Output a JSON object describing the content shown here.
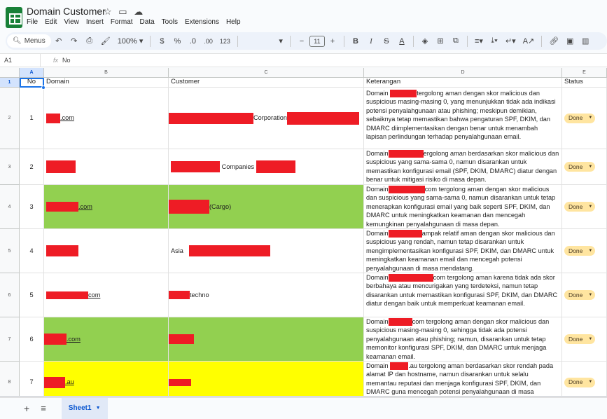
{
  "app": {
    "title": "Domain Customer",
    "icon": "sheets-logo-icon"
  },
  "title_icons": [
    "star-icon",
    "move-to-folder-icon",
    "cloud-status-icon"
  ],
  "menu": [
    "File",
    "Edit",
    "View",
    "Insert",
    "Format",
    "Data",
    "Tools",
    "Extensions",
    "Help"
  ],
  "toolbar": {
    "search_label": "Menus",
    "zoom": "100%",
    "currency": "$",
    "percent": "%",
    "decimal_decrease": ".0",
    "decimal_increase": ".00",
    "number_format": "123",
    "font_size": "11"
  },
  "formula_bar": {
    "name_box": "A1",
    "fx": "fx",
    "value": "No"
  },
  "columns": [
    "A",
    "B",
    "C",
    "D",
    "E"
  ],
  "rows": [
    "1",
    "2",
    "3",
    "4",
    "5",
    "6",
    "7",
    "8"
  ],
  "headers": {
    "no": "No",
    "domain": "Domain",
    "customer": "Customer",
    "keterangan": "Keterangan",
    "status": "Status"
  },
  "records": [
    {
      "no": "1",
      "domain_suffix": ".com",
      "customer_text": "Corporation",
      "keterangan": "tergolong aman dengan skor malicious dan suspicious masing-masing 0, yang menunjukkan tidak ada indikasi potensi penyalahgunaan atau phishing; meskipun demikian, sebaiknya tetap memastikan bahwa pengaturan SPF, DKIM, dan DMARC diimplementasikan dengan benar untuk menambah lapisan perlindungan terhadap penyalahgunaan email.",
      "status": "Done"
    },
    {
      "no": "2",
      "domain_suffix": "",
      "customer_text": "Companies",
      "keterangan": "ergolong aman berdasarkan skor malicious dan suspicious yang sama-sama 0, namun disarankan untuk memastikan konfigurasi email (SPF, DKIM, DMARC) diatur dengan benar untuk mitigasi risiko di masa depan.",
      "status": "Done"
    },
    {
      "no": "3",
      "domain_suffix": ".com",
      "customer_text": "(Cargo)",
      "keterangan": "com tergolong aman dengan skor malicious dan suspicious yang sama-sama 0, namun disarankan untuk tetap menerapkan konfigurasi email yang baik seperti SPF, DKIM, dan DMARC untuk meningkatkan keamanan dan mencegah kemungkinan penyalahgunaan di masa depan.",
      "status": "Done"
    },
    {
      "no": "4",
      "domain_suffix": "",
      "customer_text": "Asia",
      "keterangan": "ampak relatif aman dengan skor malicious dan suspicious yang rendah, namun tetap disarankan untuk mengimplementasikan konfigurasi SPF, DKIM, dan DMARC untuk meningkatkan keamanan email dan mencegah potensi penyalahgunaan di masa mendatang.",
      "status": "Done"
    },
    {
      "no": "5",
      "domain_suffix": "com",
      "customer_text": "techno",
      "keterangan": "com tergolong aman karena tidak ada skor berbahaya atau mencurigakan yang terdeteksi, namun tetap disarankan untuk memastikan konfigurasi SPF, DKIM, dan DMARC diatur dengan baik untuk memperkuat keamanan email.",
      "status": "Done"
    },
    {
      "no": "6",
      "domain_suffix": ".com",
      "customer_text": "",
      "keterangan": "com tergolong aman dengan skor malicious dan suspicious masing-masing 0, sehingga tidak ada potensi penyalahgunaan atau phishing; namun, disarankan untuk tetap memonitor konfigurasi SPF, DKIM, dan DMARC untuk menjaga keamanan email.",
      "status": "Done"
    },
    {
      "no": "7",
      "domain_suffix": ".au",
      "customer_text": "",
      "keterangan": ".au tergolong aman berdasarkan skor rendah pada alamat IP dan hostname, namun disarankan untuk selalu memantau reputasi dan menjaga konfigurasi SPF, DKIM, dan DMARC guna mencegah potensi penyalahgunaan di masa",
      "status": "Done"
    }
  ],
  "keterangan_prefix": "Domain",
  "colors": {
    "green_row": "#92d050",
    "yellow_row": "#ffff00",
    "redaction": "#ee1c25",
    "status_chip": "#ffe5a0",
    "selection": "#1a73e8"
  },
  "sheet_tab": "Sheet1"
}
